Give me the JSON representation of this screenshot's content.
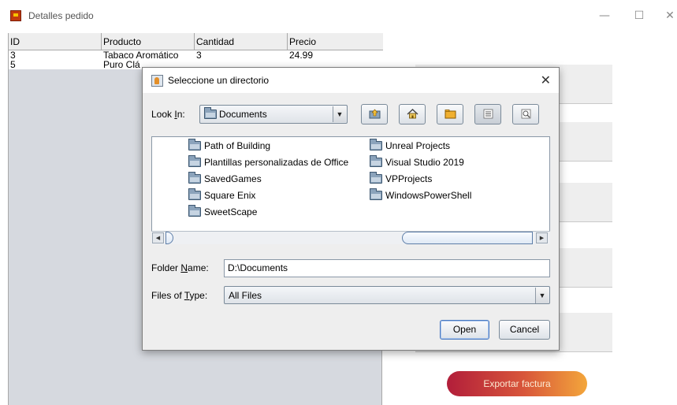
{
  "window": {
    "title": "Detalles pedido",
    "minimize": "—",
    "maximize": "☐",
    "close": "✕"
  },
  "table": {
    "columns": [
      "ID",
      "Producto",
      "Cantidad",
      "Precio"
    ],
    "rows": [
      [
        "3",
        "Tabaco Aromático",
        "3",
        "24.99"
      ],
      [
        "5",
        "Puro Clá",
        "",
        ""
      ]
    ]
  },
  "export_button": "Exportar factura",
  "dialog": {
    "title": "Seleccione un directorio",
    "close": "✕",
    "look_in_label_pre": "Look ",
    "look_in_label_key": "I",
    "look_in_label_post": "n:",
    "look_in_value": "Documents",
    "folders_col1": [
      "Path of Building",
      "Plantillas personalizadas de Office",
      "SavedGames",
      "Square Enix",
      "SweetScape"
    ],
    "folders_col2": [
      "Unreal Projects",
      "Visual Studio 2019",
      "VPProjects",
      "WindowsPowerShell"
    ],
    "folder_name_label_pre": "Folder ",
    "folder_name_label_key": "N",
    "folder_name_label_post": "ame:",
    "folder_name_value": "D:\\Documents",
    "files_of_type_label_pre": "Files of ",
    "files_of_type_label_key": "T",
    "files_of_type_label_post": "ype:",
    "files_of_type_value": "All Files",
    "open_button": "Open",
    "cancel_button": "Cancel"
  }
}
